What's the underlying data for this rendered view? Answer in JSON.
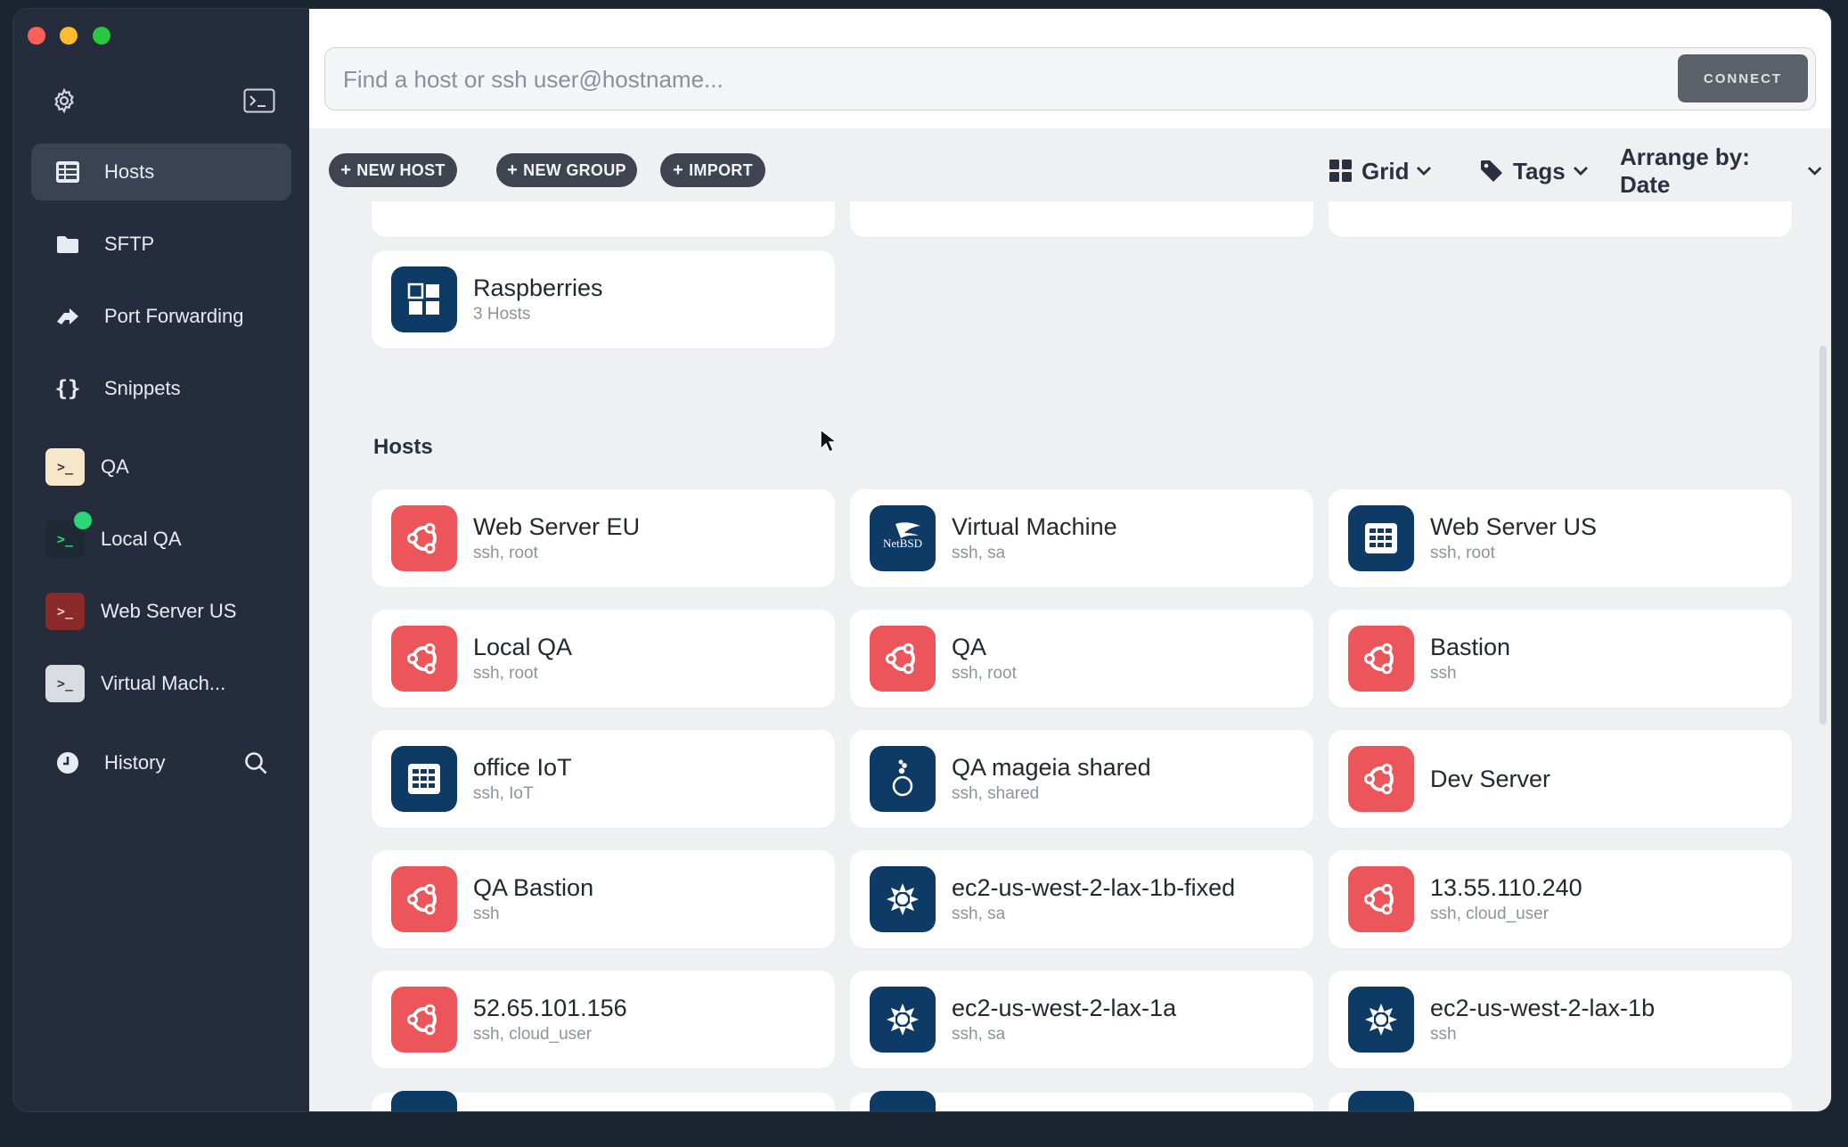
{
  "sidebar": {
    "nav": [
      {
        "label": "Hosts",
        "icon": "hosts-icon"
      },
      {
        "label": "SFTP",
        "icon": "folder-icon"
      },
      {
        "label": "Port Forwarding",
        "icon": "port-forwarding-icon"
      },
      {
        "label": "Snippets",
        "icon": "braces-icon"
      }
    ],
    "sessions": [
      {
        "label": "QA",
        "bg": "#f7e6c9",
        "fg": "#3a3a3a"
      },
      {
        "label": "Local QA",
        "bg": "#1e2a33",
        "fg": "#2bd677",
        "status": "online"
      },
      {
        "label": "Web Server US",
        "bg": "#8a2a2a",
        "fg": "#ffd0d0"
      },
      {
        "label": "Virtual Mach...",
        "bg": "#d9dde2",
        "fg": "#3a3a3a"
      }
    ],
    "history_label": "History",
    "session_prompt": ">_"
  },
  "search": {
    "placeholder": "Find a host or ssh user@hostname...",
    "connect_label": "CONNECT"
  },
  "toolbar": {
    "new_host": "NEW HOST",
    "new_group": "NEW GROUP",
    "import": "IMPORT",
    "plus": "+",
    "view_label": "Grid",
    "tags_label": "Tags",
    "arrange_label": "Arrange by: Date"
  },
  "groups": [
    {
      "name": "Raspberries",
      "count": "3 Hosts",
      "icon": "raspberry-grid-icon"
    }
  ],
  "hosts_section_title": "Hosts",
  "hosts": [
    {
      "name": "Web Server EU",
      "sub": "ssh, root",
      "icon": "ubuntu-icon",
      "color": "red"
    },
    {
      "name": "Virtual Machine",
      "sub": "ssh, sa",
      "icon": "netbsd-icon",
      "color": "navy"
    },
    {
      "name": "Web Server US",
      "sub": "ssh, root",
      "icon": "server-icon",
      "color": "navy"
    },
    {
      "name": "Local QA",
      "sub": "ssh, root",
      "icon": "ubuntu-icon",
      "color": "red"
    },
    {
      "name": "QA",
      "sub": "ssh, root",
      "icon": "ubuntu-icon",
      "color": "red"
    },
    {
      "name": "Bastion",
      "sub": "ssh",
      "icon": "ubuntu-icon",
      "color": "red"
    },
    {
      "name": "office IoT",
      "sub": "ssh, IoT",
      "icon": "server-icon",
      "color": "navy"
    },
    {
      "name": "QA mageia shared",
      "sub": "ssh, shared",
      "icon": "mageia-icon",
      "color": "navy"
    },
    {
      "name": "Dev Server",
      "sub": "",
      "icon": "ubuntu-icon",
      "color": "red"
    },
    {
      "name": "QA Bastion",
      "sub": "ssh",
      "icon": "ubuntu-icon",
      "color": "red"
    },
    {
      "name": "ec2-us-west-2-lax-1b-fixed",
      "sub": "ssh, sa",
      "icon": "aws-icon",
      "color": "navy"
    },
    {
      "name": "13.55.110.240",
      "sub": "ssh, cloud_user",
      "icon": "ubuntu-icon",
      "color": "red"
    },
    {
      "name": "52.65.101.156",
      "sub": "ssh, cloud_user",
      "icon": "ubuntu-icon",
      "color": "red"
    },
    {
      "name": "ec2-us-west-2-lax-1a",
      "sub": "ssh, sa",
      "icon": "aws-icon",
      "color": "navy"
    },
    {
      "name": "ec2-us-west-2-lax-1b",
      "sub": "ssh",
      "icon": "aws-icon",
      "color": "navy"
    }
  ],
  "netbsd_text": "NetBSD",
  "colors": {
    "red": "#ec5559",
    "navy": "#0e3a66",
    "accent_online": "#2bd677"
  }
}
